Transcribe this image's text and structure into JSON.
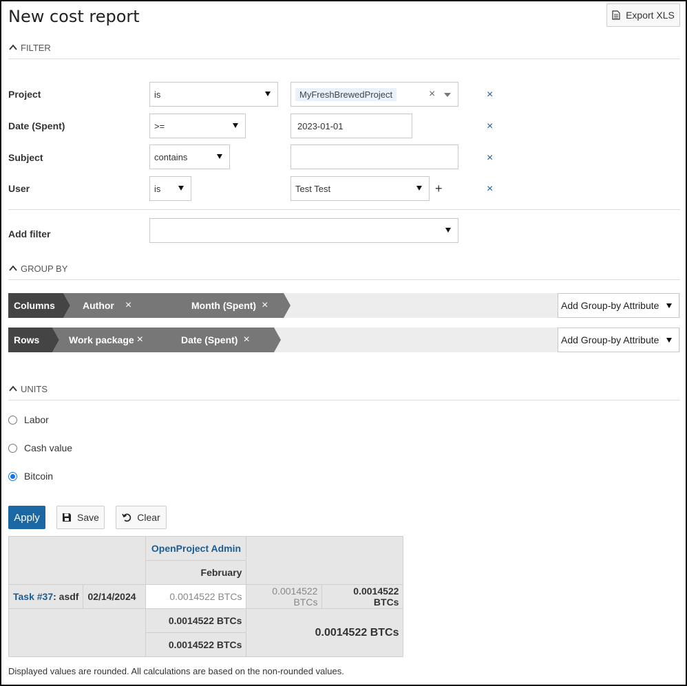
{
  "page": {
    "title": "New cost report",
    "export_label": "Export XLS"
  },
  "filter": {
    "heading": "FILTER",
    "rows": [
      {
        "label": "Project",
        "operator": "is",
        "value": "MyFreshBrewedProject"
      },
      {
        "label": "Date (Spent)",
        "operator": ">=",
        "value": "2023-01-01"
      },
      {
        "label": "Subject",
        "operator": "contains",
        "value": ""
      },
      {
        "label": "User",
        "operator": "is",
        "value": "Test Test"
      }
    ],
    "add_filter_label": "Add filter",
    "remove_glyph": "×",
    "plus_glyph": "+",
    "clear_glyph": "×"
  },
  "group_by": {
    "heading": "GROUP BY",
    "columns": {
      "label": "Columns",
      "items": [
        "Author",
        "Month (Spent)"
      ]
    },
    "rows": {
      "label": "Rows",
      "items": [
        "Work package",
        "Date (Spent)"
      ]
    },
    "add_label": "Add Group-by Attribute",
    "remove_glyph": "×"
  },
  "units": {
    "heading": "UNITS",
    "options": [
      {
        "label": "Labor",
        "checked": false
      },
      {
        "label": "Cash value",
        "checked": false
      },
      {
        "label": "Bitcoin",
        "checked": true
      }
    ]
  },
  "actions": {
    "apply": "Apply",
    "save": "Save",
    "clear": "Clear"
  },
  "report": {
    "author": "OpenProject Admin",
    "month": "February",
    "row": {
      "task_link": "Task #37",
      "task_rest": ": asdf",
      "date": "02/14/2024",
      "cell_value": "0.0014522 BTCs",
      "subtotal": "0.0014522 BTCs",
      "row_total": "0.0014522 BTCs"
    },
    "col_total_1": "0.0014522 BTCs",
    "col_total_2": "0.0014522 BTCs",
    "grand_total": "0.0014522 BTCs"
  },
  "footnote": "Displayed values are rounded. All calculations are based on the non-rounded values."
}
